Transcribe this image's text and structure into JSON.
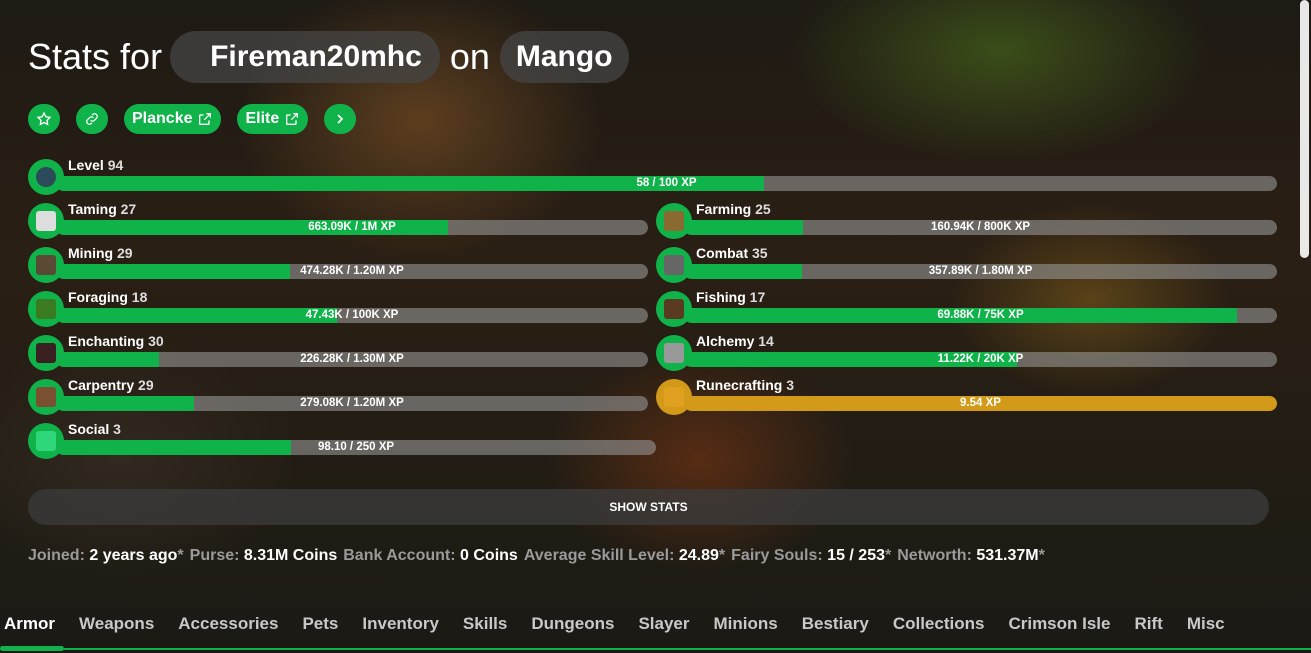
{
  "header": {
    "stats_for": "Stats for",
    "player": "Fireman20mhc",
    "on": "on",
    "profile": "Mango"
  },
  "buttons": {
    "plancke": "Plancke",
    "elite": "Elite"
  },
  "level": {
    "name": "Level",
    "lv": "94",
    "xp": "58 / 100 XP",
    "progress": 0.58
  },
  "skills_left": [
    {
      "name": "Taming",
      "lv": "27",
      "xp": "663.09K / 1M XP",
      "progress": 0.663,
      "icon": "spawn-egg-icon"
    },
    {
      "name": "Mining",
      "lv": "29",
      "xp": "474.28K / 1.20M XP",
      "progress": 0.395,
      "icon": "pickaxe-icon"
    },
    {
      "name": "Foraging",
      "lv": "18",
      "xp": "47.43K / 100K XP",
      "progress": 0.474,
      "icon": "sapling-icon"
    },
    {
      "name": "Enchanting",
      "lv": "30",
      "xp": "226.28K / 1.30M XP",
      "progress": 0.174,
      "icon": "enchanting-table-icon"
    },
    {
      "name": "Carpentry",
      "lv": "29",
      "xp": "279.08K / 1.20M XP",
      "progress": 0.233,
      "icon": "crafting-table-icon"
    },
    {
      "name": "Social",
      "lv": "3",
      "xp": "98.10 / 250 XP",
      "progress": 0.392,
      "icon": "emerald-icon"
    }
  ],
  "skills_right": [
    {
      "name": "Farming",
      "lv": "25",
      "xp": "160.94K / 800K XP",
      "progress": 0.201,
      "icon": "hoe-icon"
    },
    {
      "name": "Combat",
      "lv": "35",
      "xp": "357.89K / 1.80M XP",
      "progress": 0.199,
      "icon": "sword-icon"
    },
    {
      "name": "Fishing",
      "lv": "17",
      "xp": "69.88K / 75K XP",
      "progress": 0.932,
      "icon": "fishing-rod-icon"
    },
    {
      "name": "Alchemy",
      "lv": "14",
      "xp": "11.22K / 20K XP",
      "progress": 0.561,
      "icon": "brewing-stand-icon"
    },
    {
      "name": "Runecrafting",
      "lv": "3",
      "xp": "9.54 XP",
      "progress": 1.0,
      "icon": "magma-cream-icon",
      "maxed": true
    }
  ],
  "show_stats": "SHOW STATS",
  "info": [
    {
      "k": "Joined:",
      "v": "2 years ago",
      "ast": "*"
    },
    {
      "k": "Purse:",
      "v": "8.31M Coins",
      "ast": ""
    },
    {
      "k": "Bank Account:",
      "v": "0 Coins",
      "ast": ""
    },
    {
      "k": "Average Skill Level:",
      "v": "24.89",
      "ast": "*"
    },
    {
      "k": "Fairy Souls:",
      "v": "15 / 253",
      "ast": "*"
    },
    {
      "k": "Networth:",
      "v": "531.37M",
      "ast": "*"
    }
  ],
  "tabs": [
    "Armor",
    "Weapons",
    "Accessories",
    "Pets",
    "Inventory",
    "Skills",
    "Dungeons",
    "Slayer",
    "Minions",
    "Bestiary",
    "Collections",
    "Crimson Isle",
    "Rift",
    "Misc"
  ],
  "colors": {
    "accent": "#10b34a",
    "gold": "#d29a18"
  }
}
